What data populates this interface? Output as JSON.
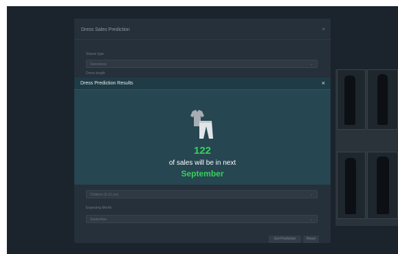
{
  "form": {
    "title": "Dress Sales Prediction",
    "close_glyph": "×",
    "fields": [
      {
        "label": "Sleeve type",
        "value": "Sleeveless"
      },
      {
        "label": "Dress length",
        "value": ""
      },
      {
        "label": "",
        "value": "Children (6-12 yrs)"
      },
      {
        "label": "Expecting Month",
        "value": "September"
      }
    ],
    "caret_glyph": "⌄",
    "buttons": {
      "predict": "Get Prediction",
      "reset": "Reset"
    }
  },
  "result": {
    "title": "Dress Prediction Results",
    "close_glyph": "×",
    "sales_count": "122",
    "message": "of sales will be in next",
    "month": "September",
    "icon": "clothes-icon"
  },
  "colors": {
    "background": "#1b232d",
    "modal_header": "#1f3b45",
    "modal_body": "#264651",
    "accent_green": "#35d25a"
  }
}
